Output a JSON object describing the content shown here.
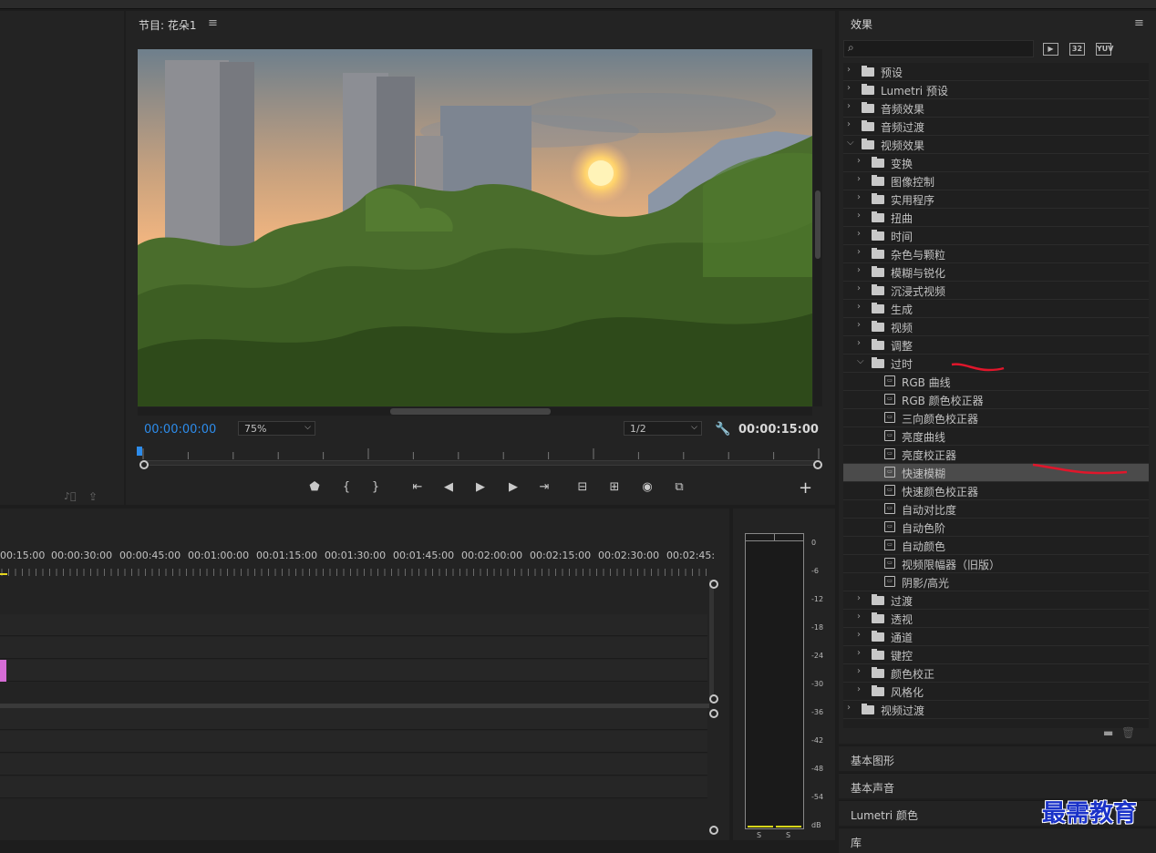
{
  "program_monitor": {
    "title": "节目: 花朵1",
    "menu_icon": "hamburger-menu-icon",
    "timecode_current": "00:00:00:00",
    "zoom": "75%",
    "resolution": "1/2",
    "timecode_duration": "00:00:15:00",
    "transport": [
      "marker-icon",
      "mark-in-icon",
      "mark-out-icon",
      "go-to-in-icon",
      "step-back-icon",
      "play-icon",
      "step-forward-icon",
      "go-to-out-icon",
      "lift-icon",
      "extract-icon",
      "export-frame-icon",
      "compare-icon"
    ],
    "transport_glyphs": [
      "⬟",
      "{",
      "}",
      "⇤",
      "◀",
      "▶",
      "▶",
      "⇥",
      "⊟",
      "⊞",
      "◉",
      "⧉"
    ],
    "add_button": "+"
  },
  "timeline": {
    "timecodes": [
      "00:15:00",
      "00:00:30:00",
      "00:00:45:00",
      "00:01:00:00",
      "00:01:15:00",
      "00:01:30:00",
      "00:01:45:00",
      "00:02:00:00",
      "00:02:15:00",
      "00:02:30:00",
      "00:02:45:"
    ]
  },
  "meter": {
    "labels": [
      "0",
      "-6",
      "-12",
      "-18",
      "-24",
      "-30",
      "-36",
      "-42",
      "-48",
      "-54",
      "dB"
    ],
    "channels": [
      "S",
      "S"
    ]
  },
  "effects": {
    "title": "效果",
    "search_placeholder": "",
    "icon_buttons": [
      "32",
      "YUV"
    ],
    "tree": [
      {
        "label": "预设",
        "level": 0,
        "type": "preset-folder",
        "expanded": false
      },
      {
        "label": "Lumetri 预设",
        "level": 0,
        "type": "preset-folder",
        "expanded": false
      },
      {
        "label": "音频效果",
        "level": 0,
        "type": "folder",
        "expanded": false
      },
      {
        "label": "音频过渡",
        "level": 0,
        "type": "folder",
        "expanded": false
      },
      {
        "label": "视频效果",
        "level": 0,
        "type": "folder",
        "expanded": true
      },
      {
        "label": "变换",
        "level": 1,
        "type": "folder",
        "expanded": false
      },
      {
        "label": "图像控制",
        "level": 1,
        "type": "folder",
        "expanded": false
      },
      {
        "label": "实用程序",
        "level": 1,
        "type": "folder",
        "expanded": false
      },
      {
        "label": "扭曲",
        "level": 1,
        "type": "folder",
        "expanded": false
      },
      {
        "label": "时间",
        "level": 1,
        "type": "folder",
        "expanded": false
      },
      {
        "label": "杂色与颗粒",
        "level": 1,
        "type": "folder",
        "expanded": false
      },
      {
        "label": "模糊与锐化",
        "level": 1,
        "type": "folder",
        "expanded": false
      },
      {
        "label": "沉浸式视频",
        "level": 1,
        "type": "folder",
        "expanded": false
      },
      {
        "label": "生成",
        "level": 1,
        "type": "folder",
        "expanded": false
      },
      {
        "label": "视频",
        "level": 1,
        "type": "folder",
        "expanded": false
      },
      {
        "label": "调整",
        "level": 1,
        "type": "folder",
        "expanded": false
      },
      {
        "label": "过时",
        "level": 1,
        "type": "folder",
        "expanded": true
      },
      {
        "label": "RGB 曲线",
        "level": 2,
        "type": "effect"
      },
      {
        "label": "RGB 颜色校正器",
        "level": 2,
        "type": "effect"
      },
      {
        "label": "三向颜色校正器",
        "level": 2,
        "type": "effect"
      },
      {
        "label": "亮度曲线",
        "level": 2,
        "type": "effect"
      },
      {
        "label": "亮度校正器",
        "level": 2,
        "type": "effect"
      },
      {
        "label": "快速模糊",
        "level": 2,
        "type": "effect",
        "selected": true
      },
      {
        "label": "快速颜色校正器",
        "level": 2,
        "type": "effect"
      },
      {
        "label": "自动对比度",
        "level": 2,
        "type": "effect"
      },
      {
        "label": "自动色阶",
        "level": 2,
        "type": "effect"
      },
      {
        "label": "自动颜色",
        "level": 2,
        "type": "effect"
      },
      {
        "label": "视频限幅器（旧版）",
        "level": 2,
        "type": "effect"
      },
      {
        "label": "阴影/高光",
        "level": 2,
        "type": "effect"
      },
      {
        "label": "过渡",
        "level": 1,
        "type": "folder",
        "expanded": false
      },
      {
        "label": "透视",
        "level": 1,
        "type": "folder",
        "expanded": false
      },
      {
        "label": "通道",
        "level": 1,
        "type": "folder",
        "expanded": false
      },
      {
        "label": "键控",
        "level": 1,
        "type": "folder",
        "expanded": false
      },
      {
        "label": "颜色校正",
        "level": 1,
        "type": "folder",
        "expanded": false
      },
      {
        "label": "风格化",
        "level": 1,
        "type": "folder",
        "expanded": false
      },
      {
        "label": "视频过渡",
        "level": 0,
        "type": "folder",
        "expanded": false
      }
    ]
  },
  "collapsed_panels": [
    "基本图形",
    "基本声音",
    "Lumetri 颜色",
    "库"
  ],
  "watermark": "最需教育",
  "colors": {
    "accent": "#2d8ceb",
    "annotation": "#e0162b",
    "clip": "#d66cd6",
    "background": "#232323"
  }
}
